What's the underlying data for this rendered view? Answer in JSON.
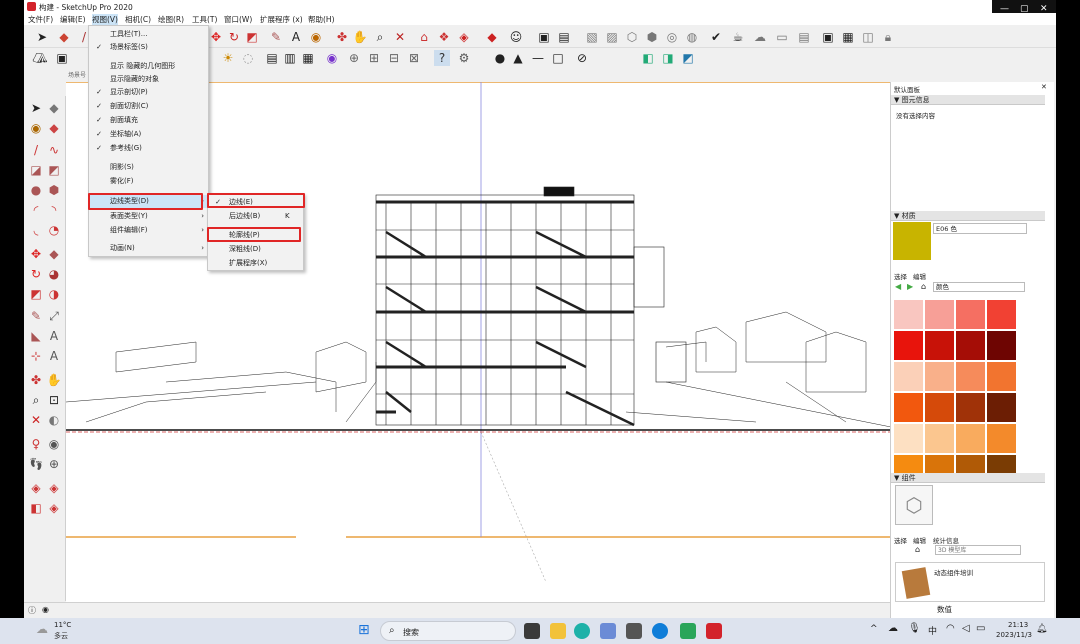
{
  "window": {
    "title": "构建 - SketchUp Pro 2020",
    "controls": {
      "minimize": "—",
      "maximize": "▢",
      "close": "✕"
    }
  },
  "menubar": {
    "items": [
      "文件(F)",
      "编辑(E)",
      "视图(V)",
      "相机(C)",
      "绘图(R)",
      "工具(T)",
      "窗口(W)",
      "扩展程序 (x)",
      "帮助(H)"
    ]
  },
  "scene_tab": {
    "line1": "两点",
    "line2": "透视"
  },
  "scene_label": "场景号",
  "view_menu": {
    "items": [
      {
        "label": "工具栏(T)...",
        "checked": false,
        "submenu": false
      },
      {
        "label": "场景标签(S)",
        "checked": true,
        "submenu": false
      },
      {
        "label": "显示 隐藏的几何图形",
        "checked": false,
        "submenu": false
      },
      {
        "label": "显示隐藏的对象",
        "checked": false,
        "submenu": false
      },
      {
        "label": "显示剖切(P)",
        "checked": true,
        "submenu": false
      },
      {
        "label": "剖面切割(C)",
        "checked": true,
        "submenu": false
      },
      {
        "label": "剖面填充",
        "checked": true,
        "submenu": false
      },
      {
        "label": "坐标轴(A)",
        "checked": true,
        "submenu": false
      },
      {
        "label": "参考线(G)",
        "checked": true,
        "submenu": false
      },
      {
        "label": "阴影(S)",
        "checked": false,
        "submenu": false
      },
      {
        "label": "雾化(F)",
        "checked": false,
        "submenu": false
      },
      {
        "label": "边线类型(D)",
        "checked": false,
        "submenu": true
      },
      {
        "label": "表面类型(Y)",
        "checked": false,
        "submenu": true
      },
      {
        "label": "组件编辑(F)",
        "checked": false,
        "submenu": true
      },
      {
        "label": "动画(N)",
        "checked": false,
        "submenu": true
      }
    ],
    "check_mark": "✓",
    "submenu_arrow": "›"
  },
  "edge_submenu": {
    "items": [
      {
        "label": "边线(E)",
        "checked": true,
        "shortcut": ""
      },
      {
        "label": "后边线(B)",
        "checked": false,
        "shortcut": "K"
      },
      {
        "label": "轮廓线(P)",
        "checked": false,
        "shortcut": ""
      },
      {
        "label": "深粗线(D)",
        "checked": false,
        "shortcut": ""
      },
      {
        "label": "扩展程序(X)",
        "checked": false,
        "shortcut": ""
      }
    ]
  },
  "tray": {
    "title": "默认面板",
    "entity_info": {
      "header": "▼ 图元信息",
      "empty_text": "没有选择内容"
    },
    "materials": {
      "header": "▼ 材质",
      "name": "E06 色",
      "swatch_color": "#c8b400",
      "tabs": {
        "select": "选择",
        "edit": "编辑"
      },
      "library": "颜色",
      "colors": [
        "#f9c6c0",
        "#f79f97",
        "#f56f62",
        "#f14133",
        "#e8140c",
        "#c81208",
        "#a50d06",
        "#6e0502",
        "#fbd0b8",
        "#f9b08a",
        "#f68b5b",
        "#f2742f",
        "#f2580e",
        "#d54a0a",
        "#a03208",
        "#6c1e04",
        "#fde0c2",
        "#fbc68f",
        "#f9ab5e",
        "#f38a2b",
        "#f58b10",
        "#d9740a",
        "#b05a06",
        "#7a3c04"
      ]
    },
    "components": {
      "header": "▼ 组件",
      "tabs": {
        "select": "选择",
        "edit": "编辑",
        "stats": "统计信息"
      },
      "search_placeholder": "3D 模型库",
      "item_label": "动态组件培训"
    },
    "footer_label": "数值"
  },
  "taskbar": {
    "weather": {
      "temp": "11°C",
      "condition": "多云"
    },
    "search_placeholder": "搜索",
    "ime": "中",
    "time": "21:13",
    "date": "2023/11/3"
  }
}
